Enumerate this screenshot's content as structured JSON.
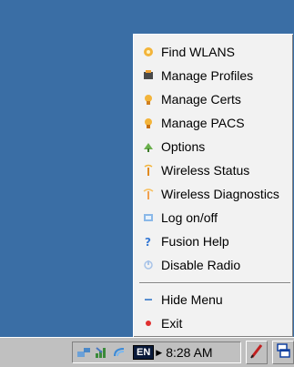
{
  "menu": {
    "items": [
      {
        "label": "Find WLANS",
        "icon": "wlan-search-icon"
      },
      {
        "label": "Manage Profiles",
        "icon": "profiles-icon"
      },
      {
        "label": "Manage Certs",
        "icon": "certificate-icon"
      },
      {
        "label": "Manage PACS",
        "icon": "pac-icon"
      },
      {
        "label": "Options",
        "icon": "options-icon"
      },
      {
        "label": "Wireless Status",
        "icon": "wireless-status-icon"
      },
      {
        "label": "Wireless Diagnostics",
        "icon": "wireless-diagnostics-icon"
      },
      {
        "label": "Log on/off",
        "icon": "logon-icon"
      },
      {
        "label": "Fusion Help",
        "icon": "help-icon"
      },
      {
        "label": "Disable Radio",
        "icon": "radio-icon"
      }
    ],
    "footer_items": [
      {
        "label": "Hide Menu",
        "icon": "hide-menu-icon"
      },
      {
        "label": "Exit",
        "icon": "exit-icon"
      }
    ]
  },
  "taskbar": {
    "input_language": "EN",
    "clock": "8:28 AM"
  },
  "colors": {
    "desktop": "#3a6ea5",
    "menu_bg": "#f2f2f2",
    "taskbar_bg": "#c0c0c0"
  }
}
